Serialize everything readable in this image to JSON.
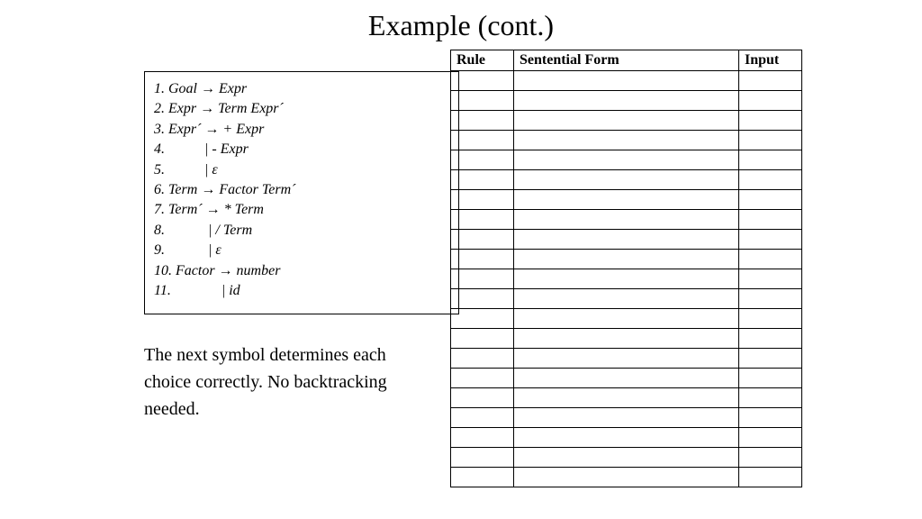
{
  "title": "Example (cont.)",
  "grammar": {
    "lines": [
      {
        "num": "1.",
        "text": "Goal → Expr"
      },
      {
        "num": "2.",
        "text": "Expr → Term Expr´"
      },
      {
        "num": "3.",
        "text": "Expr´ → + Expr"
      },
      {
        "num": "4.",
        "text": "          | - Expr"
      },
      {
        "num": "5.",
        "text": "          | ε"
      },
      {
        "num": "6.",
        "text": "Term → Factor Term´"
      },
      {
        "num": "7.",
        "text": "Term´ → * Term"
      },
      {
        "num": "8.",
        "text": "           | / Term"
      },
      {
        "num": "9.",
        "text": "           | ε"
      },
      {
        "num": "10.",
        "text": "Factor → number"
      },
      {
        "num": "11.",
        "text": "             | id"
      }
    ]
  },
  "description": "The next symbol determines each choice correctly. No backtracking needed.",
  "table": {
    "headers": [
      "Rule",
      "Sentential Form",
      "Input"
    ],
    "row_count": 21
  }
}
